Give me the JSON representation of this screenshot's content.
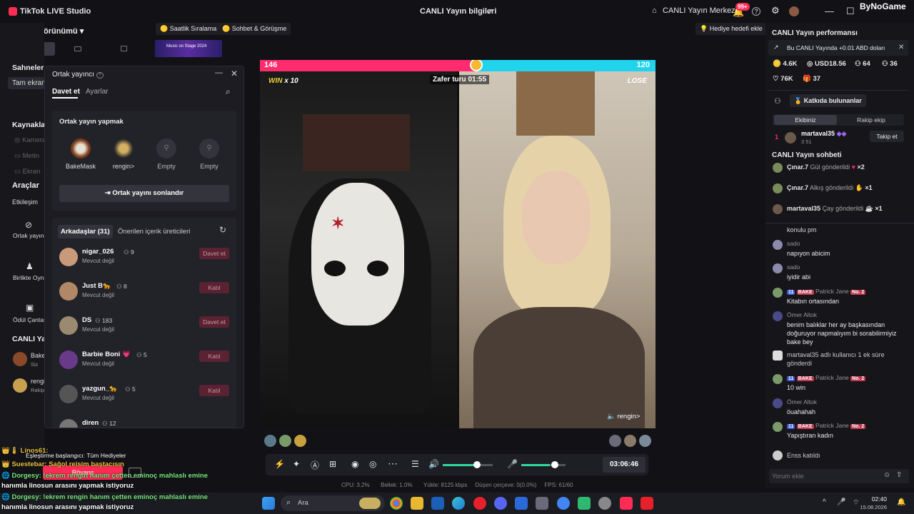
{
  "titlebar": {
    "app_name": "TikTok LIVE Studio",
    "live_info": "CANLI Yayın bilgileri",
    "live_center": "CANLI Yayın Merkezi",
    "notif_count": "99+",
    "watermark": "ByNoGame"
  },
  "studio": {
    "view_label": "Studio görünümü",
    "scenes_label": "Sahneler",
    "fullscreen_label": "Tam ekran",
    "sources_label": "Kaynaklar",
    "source_camera": "Kamera",
    "source_text": "Metin",
    "source_screen": "Ekran",
    "tools_label": "Araçlar",
    "interaction_label": "Etkileşim",
    "cohost_tool": "Ortak yayın",
    "together_tool": "Birlikte Oyna",
    "reward_tool": "Ödül Çantası",
    "live_section": "CANLI Yayın",
    "host_short": "Bake",
    "host_sub": "Siz",
    "guest_short": "rengi",
    "guest_sub": "Rakip"
  },
  "top_chips": {
    "hourly": "Saatlik Sıralama",
    "chat": "Sohbet & Görüşme",
    "gift_goal": "Hediye hedefi ekle",
    "banner_text": "Music on Stage 2024"
  },
  "popup": {
    "title": "Ortak yayıncı",
    "tab_invite": "Davet et",
    "tab_settings": "Ayarlar",
    "section_title": "Ortak yayın yapmak",
    "slots": [
      {
        "label": "BakeMask"
      },
      {
        "label": "rengin>"
      },
      {
        "label": "Empty"
      },
      {
        "label": "Empty"
      }
    ],
    "end_button": "Ortak yayını sonlandır",
    "friends_tab": "Arkadaşlar (31)",
    "suggested_tab": "Önerilen içerik üreticileri",
    "friends": [
      {
        "name": "nigar_026",
        "count": "9",
        "status": "Mevcut değil",
        "action": "Davet et"
      },
      {
        "name": "Just B🐆",
        "count": "8",
        "status": "Mevcut değil",
        "action": "Katıl"
      },
      {
        "name": "DS",
        "count": "183",
        "status": "Mevcut değil",
        "action": "Davet et"
      },
      {
        "name": "Barbie Boni 💗",
        "count": "5",
        "status": "Mevcut değil",
        "action": "Katıl"
      },
      {
        "name": "yazgun_🐆",
        "count": "5",
        "status": "Mevcut değil",
        "action": "Katıl"
      },
      {
        "name": "diren",
        "count": "12",
        "status": "",
        "action": ""
      }
    ]
  },
  "battle": {
    "left_score": "146",
    "right_score": "120",
    "left_progress": 0.545,
    "win_label": "WIN",
    "win_mult": "x 10",
    "lose_label": "LOSE",
    "timer": "Zafer turu 01:55",
    "guest_tag": "rengin>"
  },
  "controls": {
    "duration": "03:06:46"
  },
  "stats": {
    "cpu": "CPU: 3.2%",
    "memory": "Bellek: 1.0%",
    "upload": "Yükle: 8125 kbps",
    "dropped": "Düşen çerçeve: 0(0.0%)",
    "fps": "FPS: 61/60"
  },
  "performance": {
    "title": "CANLI Yayın performansı",
    "earn_notice": "Bu CANLI Yayında +0.01 ABD doları",
    "coins": "4.6K",
    "usd": "USD18.56",
    "viewers": "64",
    "likes": "36",
    "people": "76K",
    "gifts": "37",
    "contributors_btn": "Katkıda bulunanlar",
    "team_tab": "Ekibiniz",
    "rival_tab": "Rakip ekip",
    "top_rank": "1",
    "top_name": "martaval35",
    "follow_btn": "Takip et",
    "top_stats": "3   51"
  },
  "chat": {
    "title": "CANLI Yayın sohbeti",
    "gifts": [
      {
        "name": "Çınar.7",
        "text": "Gül gönderildi",
        "mult": "×2"
      },
      {
        "name": "Çınar.7",
        "text": "Alkış gönderildi",
        "mult": "×1"
      },
      {
        "name": "martaval35",
        "text": "Çay gönderildi",
        "mult": "×1"
      }
    ],
    "partial_top": "konulu pm",
    "messages": [
      {
        "name": "sado",
        "text": "napıyon abicim",
        "badge": ""
      },
      {
        "name": "sado",
        "text": "iyidir abi",
        "badge": ""
      },
      {
        "name": "Patrick Jane",
        "text": "Kitabın ortasından",
        "badge": "11",
        "team": "BAKE",
        "rank": "No. 2"
      },
      {
        "name": "Ömer Altok",
        "text": "benim balıklar her ay başkasından doğuruyor napmalıyım bi sorabilirmiyiz bake bey",
        "badge": ""
      },
      {
        "name": "",
        "text": "martaval35  adlı kullanıcı 1 ek süre gönderdi",
        "badge": ""
      },
      {
        "name": "Patrick Jane",
        "text": "10 win",
        "badge": "11",
        "team": "BAKE",
        "rank": "No. 2"
      },
      {
        "name": "Ömer Altok",
        "text": "öuahahah",
        "badge": ""
      },
      {
        "name": "Patrick Jane",
        "text": "Yapıştıran kadın",
        "badge": "11",
        "team": "BAKE",
        "rank": "No. 2"
      },
      {
        "name": "",
        "text": "Enss  katıldı",
        "badge": ""
      }
    ],
    "input_placeholder": "Yorum ekle"
  },
  "overlay": {
    "line1": "Linos61:",
    "line2": "Eşleştirme başlangıcı: Tüm Hediyeler",
    "line3": "Suestebar: Sağol reisim baştacısın",
    "line4": "Dorgesy: !ekrem rengin hanım çetten eminoç mahlaslı emine",
    "line5": "hanımla linosun arasını yapmak istiyoruz",
    "line6": "Dorgesy: !ekrem rengin hanım çetten eminoç mahlaslı emine",
    "line7": "hanımla linosun arasını yapmak istiyoruz",
    "button": "Rövanş"
  },
  "taskbar": {
    "search_placeholder": "Ara",
    "time": "02:40",
    "date": "15.08.2026"
  }
}
